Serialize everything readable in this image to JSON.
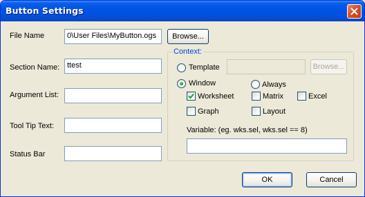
{
  "window": {
    "title": "Button Settings"
  },
  "labels": {
    "file_name": "File Name",
    "section_name": "Section Name:",
    "argument_list": "Argument List:",
    "tool_tip_text": "Tool Tip Text:",
    "status_bar": "Status Bar"
  },
  "fields": {
    "file_name": "0\\User Files\\MyButton.ogs",
    "section_name": "ttest",
    "argument_list": "",
    "tool_tip_text": "",
    "status_bar": "",
    "template": "",
    "variable": ""
  },
  "buttons": {
    "browse_file": "Browse...",
    "browse_template": "Browse...",
    "ok": "OK",
    "cancel": "Cancel"
  },
  "context": {
    "legend": "Context:",
    "template_label": "Template",
    "window_label": "Window",
    "always_label": "Always",
    "worksheet_label": "Worksheet",
    "matrix_label": "Matrix",
    "excel_label": "Excel",
    "graph_label": "Graph",
    "layout_label": "Layout",
    "variable_label": "Variable: (eg. wks.sel, wks.sel == 8)",
    "selected_radio": "Window",
    "worksheet_checked": true,
    "matrix_checked": false,
    "excel_checked": false,
    "graph_checked": false,
    "layout_checked": false,
    "always_checked": false
  },
  "icons": {
    "close": "close-icon",
    "check": "checkmark-icon"
  },
  "colors": {
    "titlebar": "#0054E3",
    "face": "#ECE9D8",
    "group_legend": "#0046D5",
    "border": "#7F9DB9"
  }
}
